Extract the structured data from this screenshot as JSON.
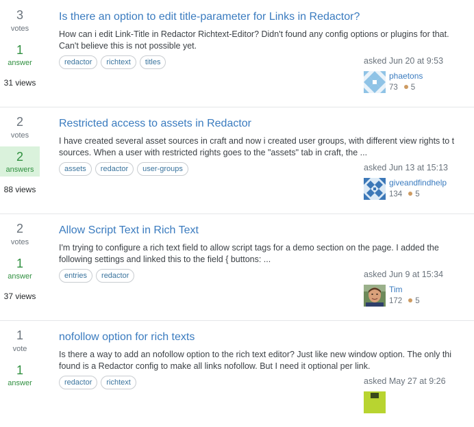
{
  "questions": [
    {
      "votes": "3",
      "votes_label": "votes",
      "answers": "1",
      "answers_label": "answer",
      "views": "31 views",
      "title": "Is there an option to edit title-parameter for Links in Redactor?",
      "excerpt_line1": "How can i edit Link-Title in Redactor Richtext-Editor? Didn't found any config options or plugins for that.",
      "excerpt_line2": "Can't believe this is not possible yet.",
      "tags": [
        "redactor",
        "richtext",
        "titles"
      ],
      "asked": "asked Jun 20 at 9:53",
      "user": "phaetons",
      "reputation": "73",
      "bronze": "5"
    },
    {
      "votes": "2",
      "votes_label": "votes",
      "answers": "2",
      "answers_label": "answers",
      "views": "88 views",
      "title": "Restricted access to assets in Redactor",
      "excerpt_line1": "I have created several asset sources in craft and now i created user groups, with different view rights to t",
      "excerpt_line2": "sources. When a user with restricted rights goes to the \"assets\" tab in craft, the ...",
      "tags": [
        "assets",
        "redactor",
        "user-groups"
      ],
      "asked": "asked Jun 13 at 15:13",
      "user": "giveandfindhelp",
      "reputation": "134",
      "bronze": "5"
    },
    {
      "votes": "2",
      "votes_label": "votes",
      "answers": "1",
      "answers_label": "answer",
      "views": "37 views",
      "title": "Allow Script Text in Rich Text",
      "excerpt_line1": "I'm trying to configure a rich text field to allow script tags for a demo section on the page. I added the",
      "excerpt_line2": "following settings and linked this to the field { buttons: ...",
      "tags": [
        "entries",
        "redactor"
      ],
      "asked": "asked Jun 9 at 15:34",
      "user": "Tim",
      "reputation": "172",
      "bronze": "5"
    },
    {
      "votes": "1",
      "votes_label": "vote",
      "answers": "1",
      "answers_label": "answer",
      "views": "",
      "title": "nofollow option for rich texts",
      "excerpt_line1": "Is there a way to add an nofollow option to the rich text editor? Just like new window option. The only thi",
      "excerpt_line2": "found is a Redactor config to make all links nofollow. But I need it optional per link.",
      "tags": [
        "redactor",
        "richtext"
      ],
      "asked": "asked May 27 at 9:26",
      "user": "",
      "reputation": "",
      "bronze": ""
    }
  ],
  "colors": {
    "link": "#3a7bbf",
    "answer_green": "#2f8f3f",
    "accepted_bg": "#daf2dc",
    "bronze": "#cd9b62"
  }
}
